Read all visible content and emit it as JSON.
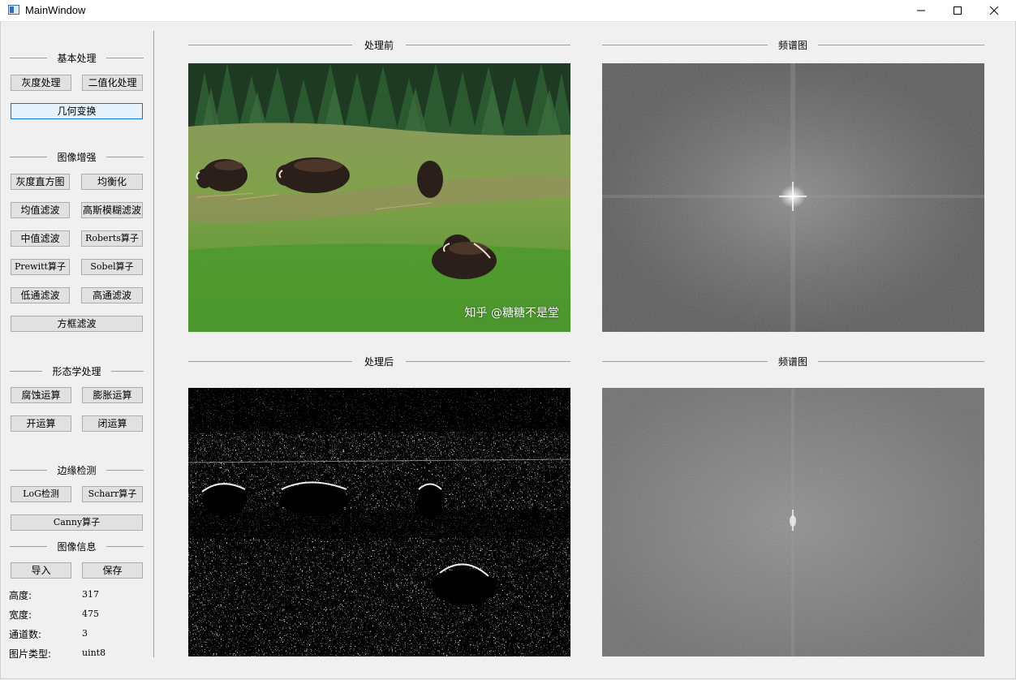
{
  "window": {
    "title": "MainWindow"
  },
  "sidebar": {
    "basic": {
      "title": "基本处理",
      "gray": "灰度处理",
      "binary": "二值化处理",
      "geometry": "几何变换"
    },
    "enhance": {
      "title": "图像增强",
      "histogram": "灰度直方图",
      "equalize": "均衡化",
      "mean_filter": "均值滤波",
      "gaussian_blur": "高斯模糊滤波",
      "median_filter": "中值滤波",
      "roberts": "Roberts算子",
      "prewitt": "Prewitt算子",
      "sobel": "Sobel算子",
      "lowpass": "低通滤波",
      "highpass": "高通滤波",
      "box_filter": "方框滤波"
    },
    "morph": {
      "title": "形态学处理",
      "erode": "腐蚀运算",
      "dilate": "膨胀运算",
      "open": "开运算",
      "close": "闭运算"
    },
    "edge": {
      "title": "边缘检测",
      "log": "LoG检测",
      "scharr": "Scharr算子",
      "canny": "Canny算子"
    },
    "info": {
      "title": "图像信息",
      "import": "导入",
      "save": "保存",
      "height_label": "高度:",
      "height_value": "317",
      "width_label": "宽度:",
      "width_value": "475",
      "channels_label": "通道数:",
      "channels_value": "3",
      "dtype_label": "图片类型:",
      "dtype_value": "uint8"
    }
  },
  "panels": {
    "before_title": "处理前",
    "before_spectrum_title": "频谱图",
    "after_title": "处理后",
    "after_spectrum_title": "频谱图",
    "watermark": "知乎 @糖糖不是堂"
  }
}
